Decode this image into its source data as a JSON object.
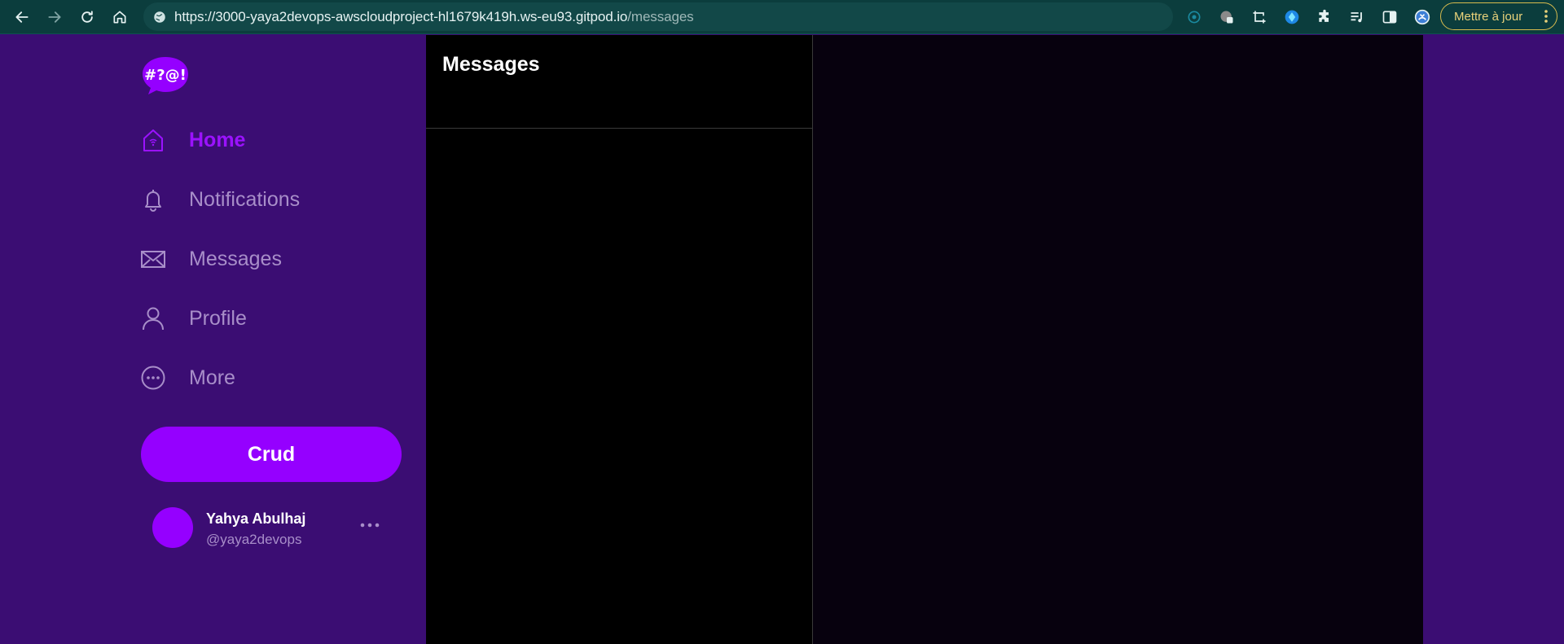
{
  "browser": {
    "url_host": "https://3000-yaya2devops-awscloudproject-hl1679k419h.ws-eu93.gitpod.io",
    "url_path": "/messages",
    "update_label": "Mettre à jour"
  },
  "sidebar": {
    "logo_text": "#?@!",
    "items": [
      {
        "label": "Home",
        "icon": "home-icon",
        "active": true
      },
      {
        "label": "Notifications",
        "icon": "bell-icon",
        "active": false
      },
      {
        "label": "Messages",
        "icon": "envelope-icon",
        "active": false
      },
      {
        "label": "Profile",
        "icon": "user-icon",
        "active": false
      },
      {
        "label": "More",
        "icon": "more-circle-icon",
        "active": false
      }
    ],
    "crud_label": "Crud",
    "user": {
      "name": "Yahya Abulhaj",
      "handle": "@yaya2devops"
    }
  },
  "main": {
    "title": "Messages"
  },
  "colors": {
    "sidebar_bg": "#3b0d73",
    "accent": "#9500ff",
    "muted_text": "#a88ec9",
    "panel_bg": "#000000",
    "chrome_bg": "#0b3d3d"
  }
}
